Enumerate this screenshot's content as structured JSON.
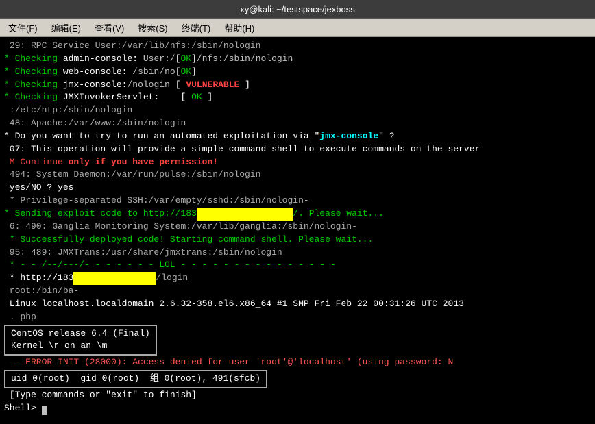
{
  "titlebar": {
    "text": "xy@kali: ~/testspace/jexboss"
  },
  "menubar": {
    "items": [
      "文件(F)",
      "编辑(E)",
      "查看(V)",
      "搜索(S)",
      "终端(T)",
      "帮助(H)"
    ]
  },
  "terminal": {
    "lines": [
      {
        "id": "l1",
        "text": " 29: RPC Service User:/var/lib/nfs:/sbin/nologin",
        "class": "gray"
      },
      {
        "id": "l2",
        "type": "checking-admin",
        "text": "* Checking admin-console: User:/["
      },
      {
        "id": "l3",
        "type": "checking-web",
        "text": "* Checking web-console: /sbin/no[OK]"
      },
      {
        "id": "l4",
        "type": "checking-jmx",
        "text": "* Checking jmx-console:/nologin [ VULNERABLE ]"
      },
      {
        "id": "l5",
        "text": "* Checking JMXInvokerServlet:    [ OK ]",
        "class": "green"
      },
      {
        "id": "l6",
        "text": " :/etc/ntp:/sbin/nologin",
        "class": "gray"
      },
      {
        "id": "l7",
        "text": " 48: Apache:/var/www:/sbin/nologin",
        "class": "gray"
      },
      {
        "id": "l8",
        "type": "question",
        "text": "* Do you want to try to run an automated exploitation via \"jmx-console\" ?"
      },
      {
        "id": "l9",
        "text": " 07: This operation will provide a simple command shell to execute commands on the server",
        "class": "white"
      },
      {
        "id": "l10",
        "text": " M Continue only if you have permission!",
        "class": "red"
      },
      {
        "id": "l11",
        "text": " 494: System Daemon:/var/run/pulse:/sbin/nologin",
        "class": "gray"
      },
      {
        "id": "l12",
        "text": " yes/NO ? yes",
        "class": "white"
      },
      {
        "id": "l13",
        "text": " * Privilege-separated SSH:/var/empty/sshd:/sbin/nologin-",
        "class": "gray"
      },
      {
        "id": "l14",
        "type": "sending",
        "text": "* Sending exploit code to http://183"
      },
      {
        "id": "l15",
        "text": " 6: 490: Ganglia Monitoring System:/var/lib/ganglia:/sbin/nologin-",
        "class": "gray"
      },
      {
        "id": "l16",
        "text": " * Successfully deployed code! Starting command shell. Please wait...",
        "class": "green"
      },
      {
        "id": "l17",
        "text": " 95: 489: JMXTrans:/usr/share/jmxtrans:/sbin/nologin",
        "class": "gray"
      },
      {
        "id": "l18",
        "type": "lol",
        "text": " * - - /--/---/- - - - - - - LOL - - - - - - - - - - - - - - -"
      },
      {
        "id": "l19",
        "text": " * http://183",
        "class": "white"
      },
      {
        "id": "l20",
        "text": " root:/bin/ba-",
        "class": "gray"
      },
      {
        "id": "l21",
        "text": " Linux localhost.localdomain 2.6.32-358.el6.x86_64 #1 SMP Fri Feb 22 00:31:26 UTC 2013",
        "class": "white"
      },
      {
        "id": "l22",
        "text": " . php",
        "class": "gray"
      },
      {
        "id": "l23-box1",
        "type": "box1",
        "text": "CentOS release 6.4 (Final)\nKernel \\r on an \\m"
      },
      {
        "id": "l24",
        "text": " -- ERROR INIT (28000): Access denied for user 'root'@'localhost' (using password: N",
        "class": "red"
      },
      {
        "id": "l25-box2",
        "type": "box2",
        "text": "uid=0(root)  gid=0(root)  组=0(root), 491(sfcb)"
      },
      {
        "id": "l26",
        "text": " [Type commands or \"exit\" to finish]",
        "class": "white"
      },
      {
        "id": "l27",
        "type": "prompt",
        "text": "Shell> "
      }
    ]
  }
}
